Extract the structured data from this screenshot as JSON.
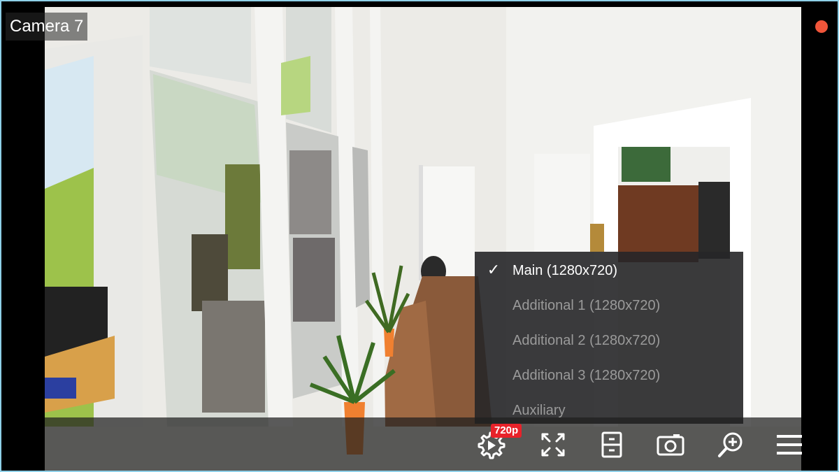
{
  "camera": {
    "title": "Camera 7",
    "recording": true
  },
  "stream_menu": {
    "items": [
      {
        "label": "Main (1280x720)",
        "selected": true
      },
      {
        "label": "Additional 1 (1280x720)",
        "selected": false
      },
      {
        "label": "Additional 2 (1280x720)",
        "selected": false
      },
      {
        "label": "Additional 3 (1280x720)",
        "selected": false
      },
      {
        "label": "Auxiliary",
        "selected": false
      }
    ],
    "check_glyph": "✓"
  },
  "toolbar": {
    "stream_badge": "720p",
    "buttons": [
      {
        "icon": "stream-settings-icon"
      },
      {
        "icon": "fullscreen-icon"
      },
      {
        "icon": "archive-icon"
      },
      {
        "icon": "snapshot-icon"
      },
      {
        "icon": "zoom-in-icon"
      },
      {
        "icon": "menu-icon"
      }
    ]
  },
  "colors": {
    "rec_dot": "#f0553a",
    "badge": "#e8222a",
    "frame_border": "#8fd0e8"
  }
}
